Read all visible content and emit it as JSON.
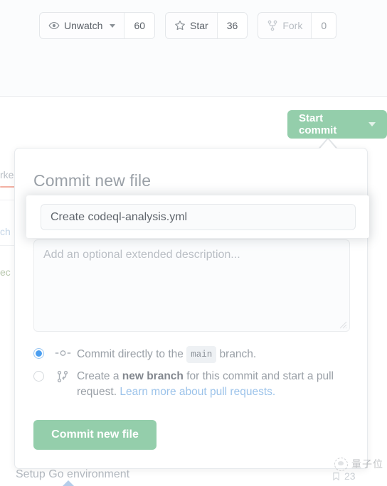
{
  "repo_actions": [
    {
      "id": "unwatch",
      "icon": "eye-icon",
      "label": "Unwatch",
      "count": "60",
      "has_caret": true,
      "dim": false
    },
    {
      "id": "star",
      "icon": "star-icon",
      "label": "Star",
      "count": "36",
      "has_caret": false,
      "dim": false
    },
    {
      "id": "fork",
      "icon": "fork-icon",
      "label": "Fork",
      "count": "0",
      "has_caret": false,
      "dim": true
    }
  ],
  "start_commit": {
    "label": "Start commit",
    "caret": "chevron-down-icon",
    "color": "#94ceab"
  },
  "commit_popup": {
    "title": "Commit new file",
    "message_value": "Create codeql-analysis.yml",
    "message_placeholder": "Create codeql-analysis.yml",
    "description_placeholder": "Add an optional extended description...",
    "description_value": "",
    "options": [
      {
        "id": "commit-directly",
        "selected": true,
        "icon": "git-commit-icon",
        "text_before": "Commit directly to the",
        "chip": "main",
        "text_after": "branch."
      },
      {
        "id": "create-new-branch",
        "selected": false,
        "icon": "git-branch-icon",
        "text_before": "Create a",
        "strong": "new branch",
        "text_after": "for this commit and start a pull request.",
        "link": "Learn more about pull requests."
      }
    ],
    "submit_label": "Commit new file",
    "submit_color": "#94ceab"
  },
  "background": {
    "tab_marketplace": "rke",
    "text_branch": "ch",
    "text_sec": "ec",
    "bottom_step": "Setup Go environment",
    "bottom_right": "23"
  },
  "watermark": {
    "text": "量子位",
    "mark": "quantum-bit-logo-icon"
  }
}
